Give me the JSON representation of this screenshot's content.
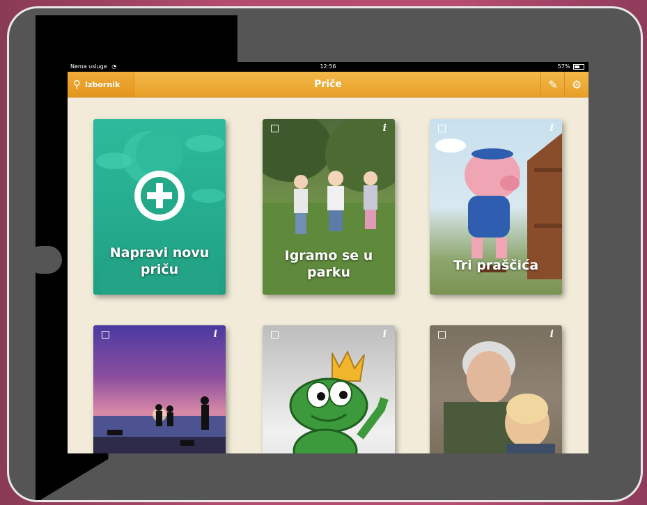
{
  "status_bar": {
    "carrier": "Nema usluge",
    "time": "12:56",
    "battery": "57%"
  },
  "nav": {
    "menu_label": "Izbornik",
    "title": "Priče"
  },
  "cards": {
    "new_story": "Napravi novu priču",
    "park": "Igramo se u parku",
    "pigs": "Tri praščića",
    "info_label": "i"
  }
}
